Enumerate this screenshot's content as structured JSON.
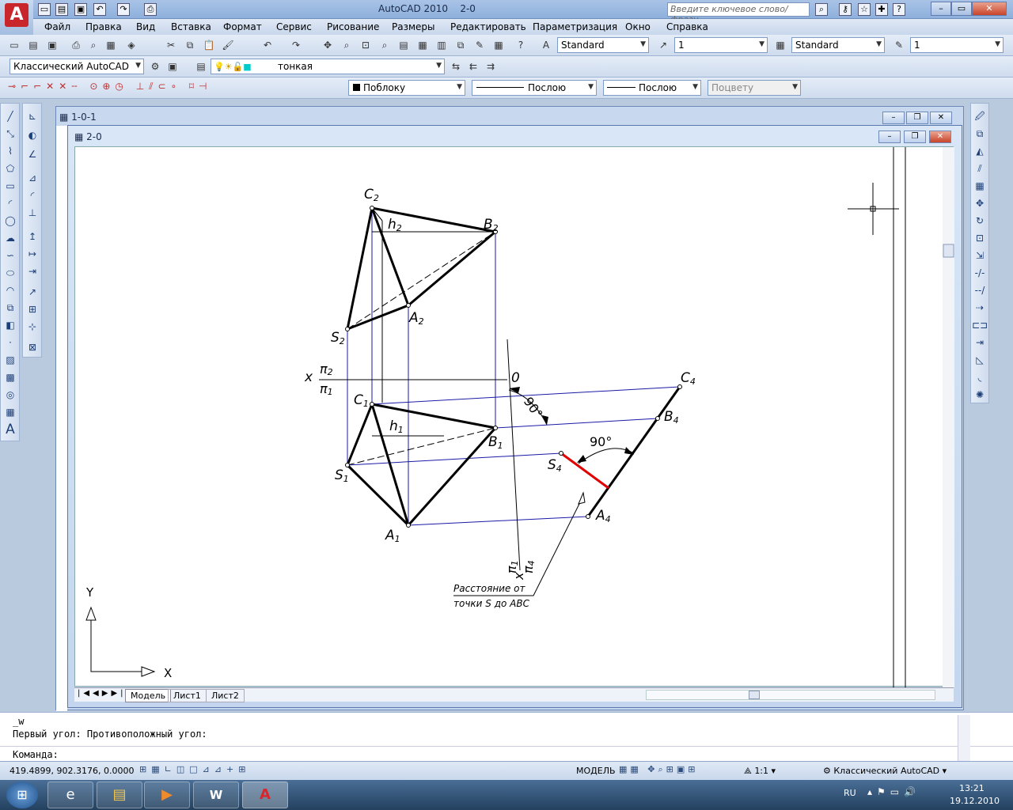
{
  "window": {
    "title": "AutoCAD 2010",
    "document": "2-0",
    "search_placeholder": "Введите ключевое слово/фразу"
  },
  "menu": [
    "Файл",
    "Правка",
    "Вид",
    "Вставка",
    "Формат",
    "Сервис",
    "Рисование",
    "Размеры",
    "Редактировать",
    "Параметризация",
    "Окно",
    "Справка"
  ],
  "toolbar1": {
    "text_style": "Standard",
    "dim_scale": "1",
    "table_style": "Standard",
    "multileader_scale": "1"
  },
  "toolbar2": {
    "workspace": "Классический AutoCAD",
    "layer": "тонкая"
  },
  "toolbar3": {
    "color": "Поблоку",
    "linetype": "Послою",
    "lineweight": "Послою",
    "plotstyle": "Поцвету"
  },
  "mdi": {
    "back_window": "1-0-1",
    "front_window": "2-0"
  },
  "drawing": {
    "labels": {
      "C2": "C",
      "B2": "B",
      "A2": "A",
      "S2": "S",
      "h2": "h",
      "C1": "C",
      "B1": "B",
      "A1": "A",
      "S1": "S",
      "h1": "h",
      "C4": "C",
      "B4": "B",
      "A4": "A",
      "S4": "S",
      "sub2": "2",
      "sub1": "1",
      "sub4": "4",
      "x": "x",
      "pi": "π",
      "zero": "0",
      "angle": "90°",
      "note1": "Расстояние от",
      "note2": "точки S до ABC",
      "ucs_x": "X",
      "ucs_y": "Y"
    }
  },
  "tabs": [
    "Модель",
    "Лист1",
    "Лист2"
  ],
  "command": {
    "line1": "_w",
    "line2": "Первый угол: Противоположный угол:",
    "prompt": "Команда:"
  },
  "status": {
    "coords": "419.4899, 902.3176, 0.0000",
    "model": "МОДЕЛЬ",
    "scale": "1:1",
    "workspace": "Классический AutoCAD"
  },
  "taskbar": {
    "lang": "RU",
    "time": "13:21",
    "date": "19.12.2010"
  }
}
